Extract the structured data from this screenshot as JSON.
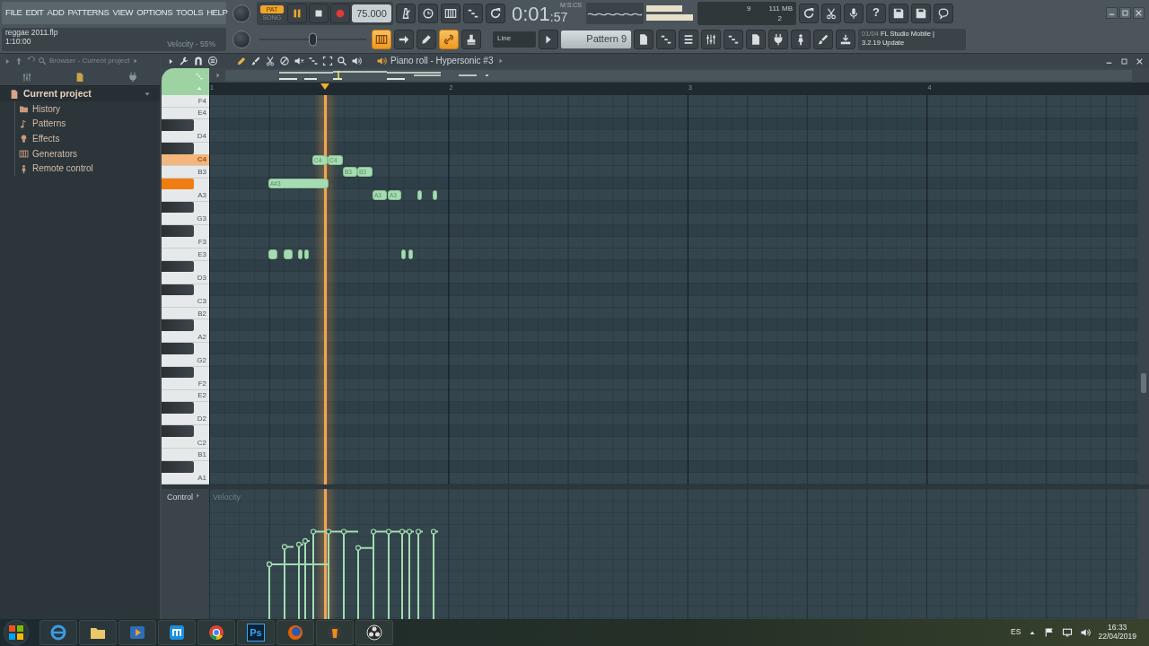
{
  "menu": [
    "FILE",
    "EDIT",
    "ADD",
    "PATTERNS",
    "VIEW",
    "OPTIONS",
    "TOOLS",
    "HELP"
  ],
  "transport": {
    "modes": [
      {
        "label": "PAT",
        "selected": true
      },
      {
        "label": "SONG",
        "selected": false
      }
    ],
    "tempo": "75.000"
  },
  "slider": {
    "level": 0.5
  },
  "time": {
    "minutes": "0:01",
    "seconds": ":57",
    "unit": "M:S:CS"
  },
  "monitor": {
    "cpu": "9",
    "memory": "111 MB",
    "voices": "2"
  },
  "help_label": "?",
  "hint": {
    "file": "reggae 2011.flp",
    "position": "1:10:00",
    "message": "Velocity - 55%"
  },
  "tool_buttons": [
    {
      "on": true
    },
    {
      "on": false
    },
    {
      "on": false
    },
    {
      "on": true
    },
    {
      "on": false
    }
  ],
  "snap": "Line",
  "pattern": "Pattern 9",
  "news": {
    "date": "01/04",
    "title": "FL Studio Mobile |",
    "detail": "3.2.19 Update"
  },
  "browser": {
    "title": "Browser - Current project",
    "root": {
      "label": "Current project",
      "expanded": true,
      "children": [
        {
          "label": "History"
        },
        {
          "label": "Patterns"
        },
        {
          "label": "Effects"
        },
        {
          "label": "Generators"
        },
        {
          "label": "Remote control"
        }
      ]
    }
  },
  "piano_roll": {
    "title": "Piano roll - Hypersonic #3",
    "bars": [
      "1",
      "2",
      "3",
      "4"
    ],
    "keys": [
      {
        "kind": "white",
        "label": "F4",
        "pressed": false
      },
      {
        "kind": "white",
        "label": "E4",
        "pressed": false
      },
      {
        "kind": "black",
        "pressed": false
      },
      {
        "kind": "white",
        "label": "D4",
        "pressed": false
      },
      {
        "kind": "black",
        "pressed": false
      },
      {
        "kind": "white",
        "label": "C4",
        "pressed": true
      },
      {
        "kind": "white",
        "label": "B3",
        "pressed": false
      },
      {
        "kind": "black",
        "pressed": true
      },
      {
        "kind": "white",
        "label": "A3",
        "pressed": false
      },
      {
        "kind": "black",
        "pressed": false
      },
      {
        "kind": "white",
        "label": "G3",
        "pressed": false
      },
      {
        "kind": "black",
        "pressed": false
      },
      {
        "kind": "white",
        "label": "F3",
        "pressed": false
      },
      {
        "kind": "white",
        "label": "E3",
        "pressed": false
      },
      {
        "kind": "black",
        "pressed": false
      },
      {
        "kind": "white",
        "label": "D3",
        "pressed": false
      },
      {
        "kind": "black",
        "pressed": false
      },
      {
        "kind": "white",
        "label": "C3",
        "pressed": false
      },
      {
        "kind": "white",
        "label": "B2",
        "pressed": false
      },
      {
        "kind": "black",
        "pressed": false
      },
      {
        "kind": "white",
        "label": "A2",
        "pressed": false
      },
      {
        "kind": "black",
        "pressed": false
      },
      {
        "kind": "white",
        "label": "G2",
        "pressed": false
      },
      {
        "kind": "black",
        "pressed": false
      },
      {
        "kind": "white",
        "label": "F2",
        "pressed": false
      },
      {
        "kind": "white",
        "label": "E2",
        "pressed": false
      },
      {
        "kind": "black",
        "pressed": false
      },
      {
        "kind": "white",
        "label": "D2",
        "pressed": false
      },
      {
        "kind": "black",
        "pressed": false
      },
      {
        "kind": "white",
        "label": "C2",
        "pressed": false
      },
      {
        "kind": "white",
        "label": "B1",
        "pressed": false
      },
      {
        "kind": "black",
        "pressed": false
      },
      {
        "kind": "white",
        "label": "A1",
        "pressed": false
      }
    ],
    "notes": [
      {
        "kind": "labeled",
        "label": "A#3"
      },
      {
        "kind": "plain"
      },
      {
        "kind": "plain"
      },
      {
        "kind": "plain"
      },
      {
        "kind": "plain"
      },
      {
        "kind": "labeled",
        "label": "C4"
      },
      {
        "kind": "labeled",
        "label": "C4"
      },
      {
        "kind": "labeled",
        "label": "B3"
      },
      {
        "kind": "labeled",
        "label": "B3"
      },
      {
        "kind": "labeled",
        "label": "A3"
      },
      {
        "kind": "labeled",
        "label": "A3"
      },
      {
        "kind": "plain"
      },
      {
        "kind": "plain"
      },
      {
        "kind": "plain"
      },
      {
        "kind": "plain"
      }
    ],
    "control": "Control",
    "control_target": "Velocity"
  },
  "taskbar": {
    "apps": [
      {
        "kind": "ie"
      },
      {
        "kind": "folder"
      },
      {
        "kind": "media"
      },
      {
        "kind": "maxthon"
      },
      {
        "kind": "chrome"
      },
      {
        "kind": "photoshop",
        "label": "Ps"
      },
      {
        "kind": "firefox"
      },
      {
        "kind": "fl"
      },
      {
        "kind": "obs"
      }
    ],
    "language": "ES",
    "time": "16:33",
    "date": "22/04/2019"
  }
}
